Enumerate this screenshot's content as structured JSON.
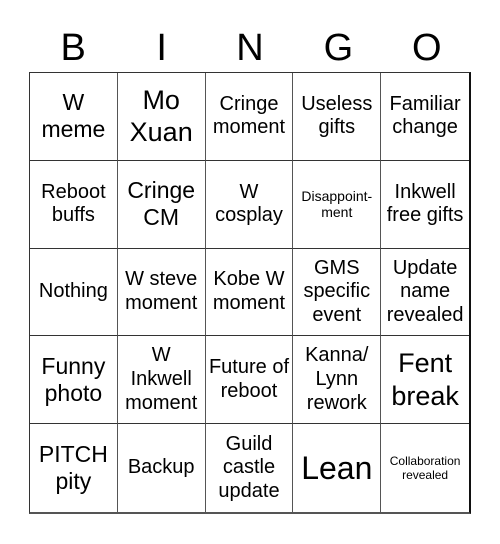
{
  "header": {
    "letters": [
      "B",
      "I",
      "N",
      "G",
      "O"
    ]
  },
  "cells": [
    {
      "text": "W meme",
      "size": "md"
    },
    {
      "text": "Mo Xuan",
      "size": "lg"
    },
    {
      "text": "Cringe moment",
      "size": "sm"
    },
    {
      "text": "Useless gifts",
      "size": "sm"
    },
    {
      "text": "Familiar change",
      "size": "sm"
    },
    {
      "text": "Reboot buffs",
      "size": "sm"
    },
    {
      "text": "Cringe CM",
      "size": "md"
    },
    {
      "text": "W cosplay",
      "size": "sm"
    },
    {
      "text": "Disappoint-ment",
      "size": "xs"
    },
    {
      "text": "Inkwell free gifts",
      "size": "sm"
    },
    {
      "text": "Nothing",
      "size": "sm"
    },
    {
      "text": "W steve moment",
      "size": "sm"
    },
    {
      "text": "Kobe W moment",
      "size": "sm"
    },
    {
      "text": "GMS specific event",
      "size": "sm"
    },
    {
      "text": "Update name revealed",
      "size": "sm"
    },
    {
      "text": "Funny photo",
      "size": "md"
    },
    {
      "text": "W Inkwell moment",
      "size": "sm"
    },
    {
      "text": "Future of reboot",
      "size": "sm"
    },
    {
      "text": "Kanna/ Lynn rework",
      "size": "sm"
    },
    {
      "text": "Fent break",
      "size": "lg"
    },
    {
      "text": "PITCH pity",
      "size": "md"
    },
    {
      "text": "Backup",
      "size": "sm"
    },
    {
      "text": "Guild castle update",
      "size": "sm"
    },
    {
      "text": "Lean",
      "size": "xl"
    },
    {
      "text": "Collaboration revealed",
      "size": "xxs"
    }
  ]
}
